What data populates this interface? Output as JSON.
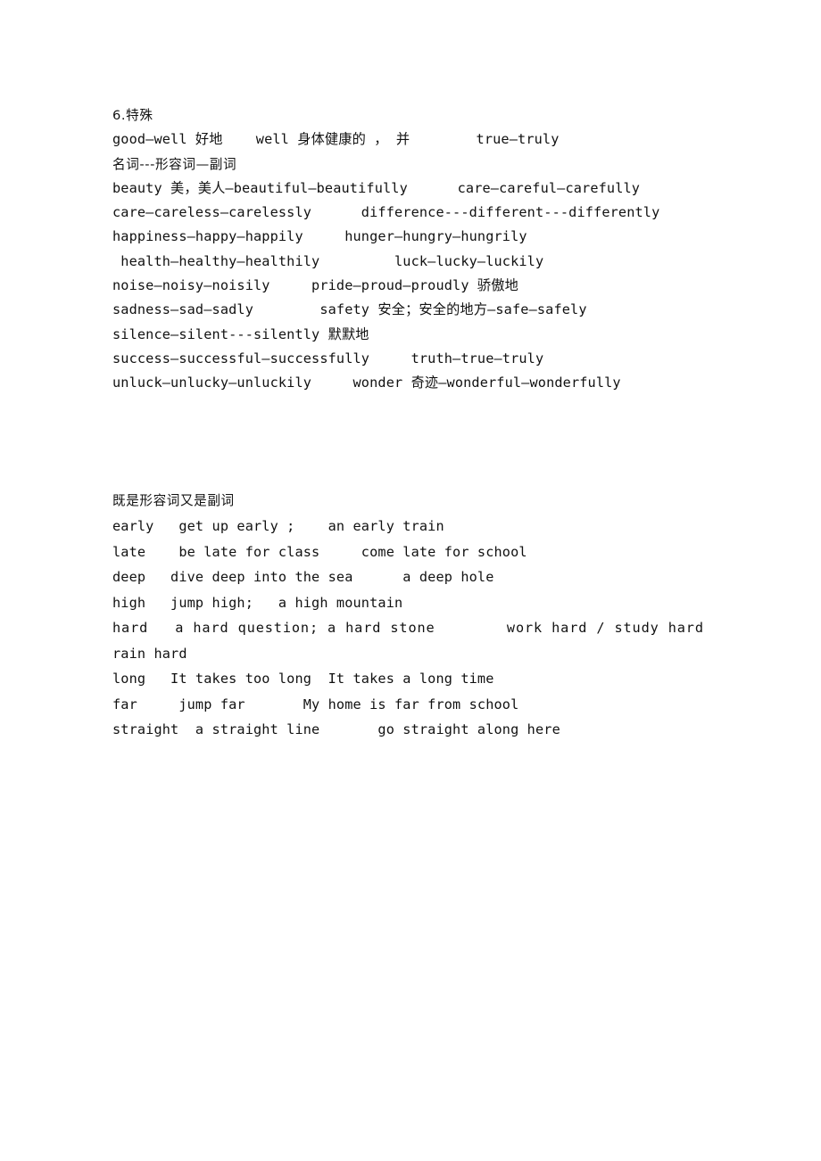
{
  "document": {
    "sections": [
      {
        "id": "special-adverbs",
        "heading": "6.特殊",
        "lines": [
          "good—well 好地    well 身体健康的 ， 并        true—truly",
          "名词---形容词—副词",
          "beauty 美，美人—beautiful—beautifully      care—careful—carefully",
          "care—careless—carelessly      difference---different---differently",
          "happiness—happy—happily     hunger—hungry—hungrily",
          " health—healthy—healthily         luck—lucky—luckily",
          "noise—noisy—noisily     pride—proud—proudly 骄傲地",
          "sadness—sad—sadly        safety 安全；安全的地方—safe—safely",
          "silence—silent---silently 默默地",
          "success—successful—successfully     truth—true—truly",
          "unluck—unlucky—unluckily     wonder 奇迹—wonderful—wonderfully"
        ]
      },
      {
        "id": "adj-and-adv",
        "heading": "既是形容词又是副词",
        "lines": [
          "early   get up early ;    an early train",
          "late    be late for class     come late for school",
          "deep   dive deep into the sea      a deep hole",
          "high   jump high;   a high mountain",
          "hard   a hard question; a hard stone        work hard / study hard",
          "rain hard",
          "long   It takes too long  It takes a long time",
          "far     jump far       My home is far from school",
          "straight  a straight line       go straight along here"
        ]
      }
    ]
  },
  "style": {
    "text_color": "#111111",
    "background_color": "#ffffff"
  }
}
